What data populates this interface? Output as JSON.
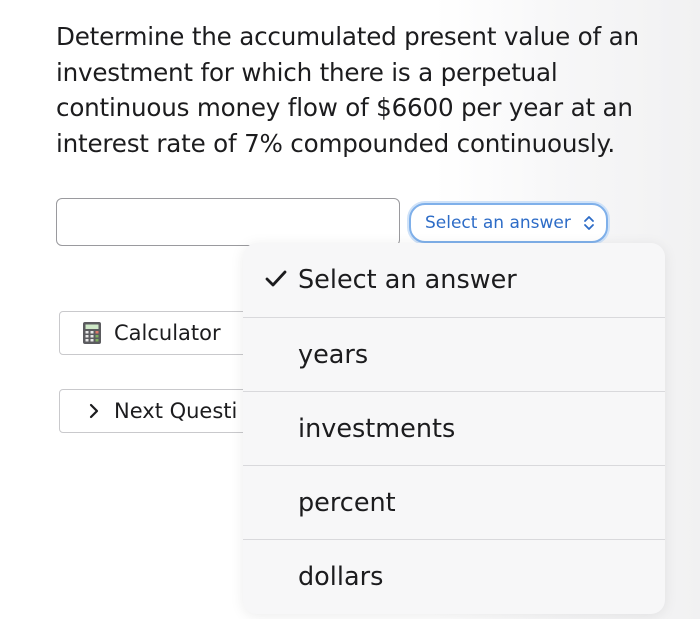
{
  "question": {
    "lines": [
      "Determine the accumulated present value of an",
      "investment for which there is a perpetual",
      "continuous money flow of $6600 per year at an",
      "interest rate of 7% compounded continuously."
    ]
  },
  "answer": {
    "value": "",
    "placeholder": ""
  },
  "unit_select": {
    "selected_label": "Select an answer",
    "options": [
      {
        "label": "Select an answer",
        "selected": true
      },
      {
        "label": "years",
        "selected": false
      },
      {
        "label": "investments",
        "selected": false
      },
      {
        "label": "percent",
        "selected": false
      },
      {
        "label": "dollars",
        "selected": false
      }
    ]
  },
  "buttons": {
    "calculator_label": "Calculator",
    "next_label": "Next Questi"
  },
  "icons": {
    "calculator": "calculator-icon",
    "next": "chevron-right-icon",
    "select": "chevron-up-down-icon",
    "checkmark": "checkmark-icon"
  },
  "colors": {
    "accent": "#2d6cc7",
    "select_border": "#7fb0ea",
    "text": "#1c1c1e",
    "menu_bg": "#f7f7f8"
  }
}
